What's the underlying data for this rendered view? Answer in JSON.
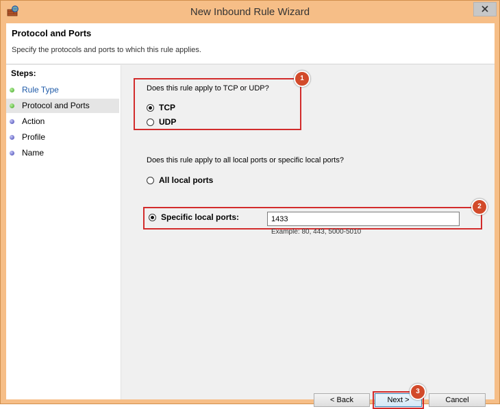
{
  "window": {
    "title": "New Inbound Rule Wizard",
    "icon": "firewall-icon",
    "close_icon": "close-icon"
  },
  "header": {
    "title": "Protocol and Ports",
    "subtitle": "Specify the protocols and ports to which this rule applies."
  },
  "steps": {
    "label": "Steps:",
    "items": [
      {
        "label": "Rule Type",
        "status": "done"
      },
      {
        "label": "Protocol and Ports",
        "status": "current"
      },
      {
        "label": "Action",
        "status": "pending"
      },
      {
        "label": "Profile",
        "status": "pending"
      },
      {
        "label": "Name",
        "status": "pending"
      }
    ]
  },
  "protocol": {
    "question": "Does this rule apply to TCP or UDP?",
    "options": [
      "TCP",
      "UDP"
    ],
    "selected": "TCP"
  },
  "ports": {
    "question": "Does this rule apply to all local ports or specific local ports?",
    "options": [
      "All local ports",
      "Specific local ports:"
    ],
    "selected": "Specific local ports:",
    "value": "1433",
    "example": "Example: 80, 443, 5000-5010"
  },
  "annotations": [
    "1",
    "2",
    "3"
  ],
  "buttons": {
    "back": "< Back",
    "next": "Next >",
    "cancel": "Cancel"
  },
  "colors": {
    "frame": "#f6be87",
    "highlight": "#d22b2b",
    "marker": "#d24a2a",
    "link": "#1e5aa8"
  }
}
